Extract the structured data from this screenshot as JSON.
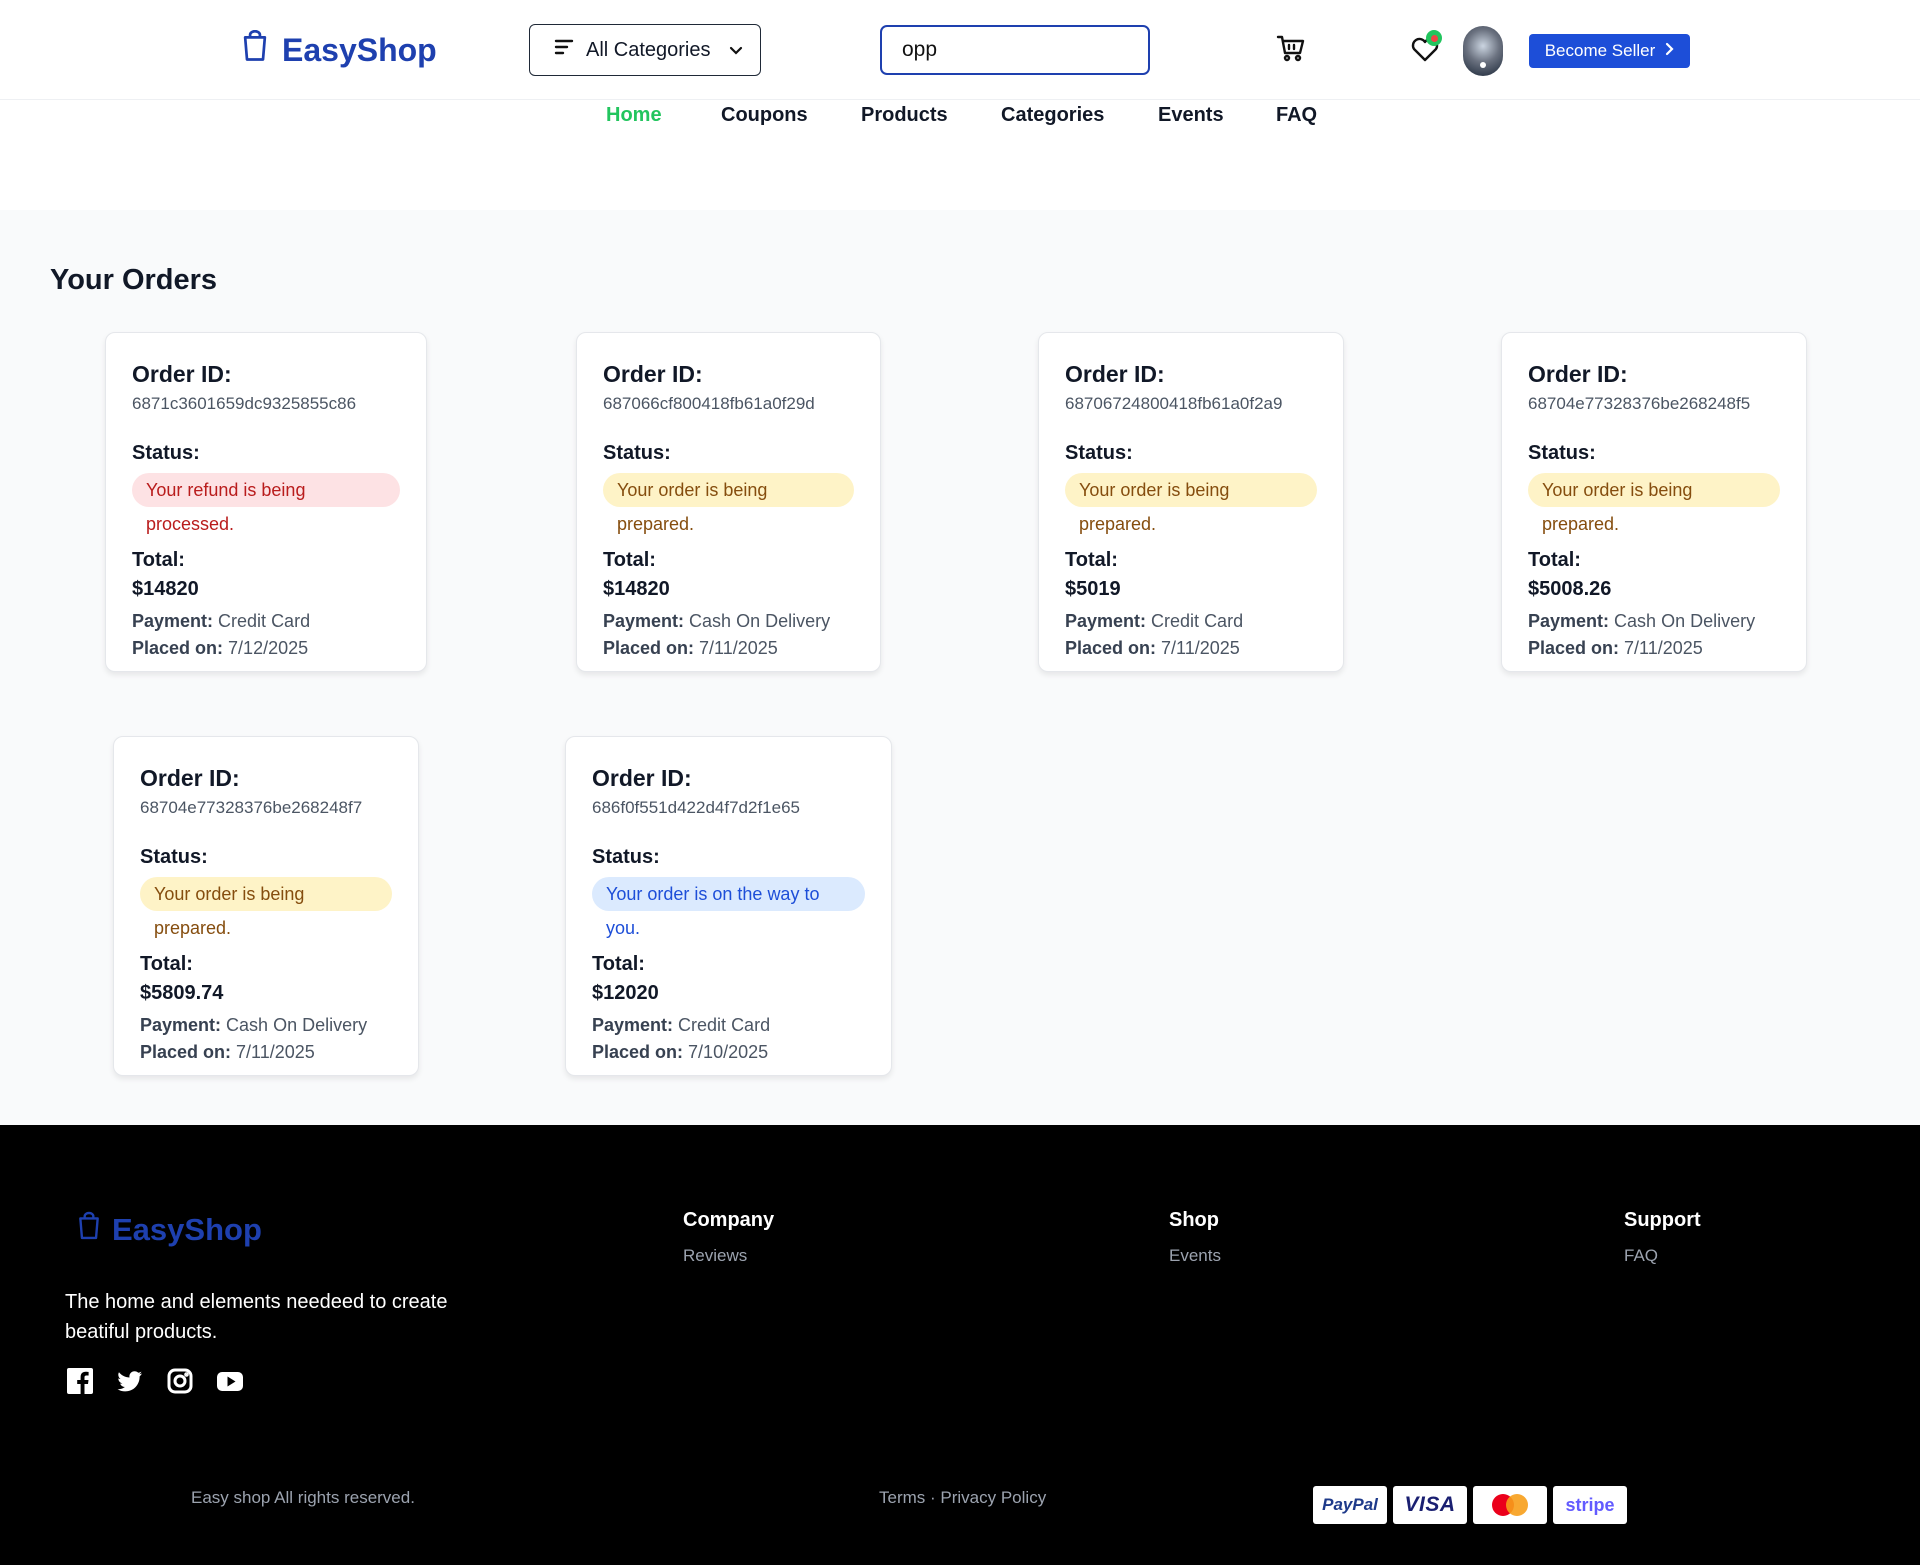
{
  "header": {
    "brand": "EasyShop",
    "categories_label": "All Categories",
    "search_value": "opp",
    "seller_label": "Become Seller"
  },
  "nav": {
    "items": [
      "Home",
      "Coupons",
      "Products",
      "Categories",
      "Events",
      "FAQ"
    ],
    "active": "Home"
  },
  "orders": {
    "title": "Your Orders",
    "labels": {
      "order_id": "Order ID:",
      "status": "Status:",
      "total": "Total:",
      "payment": "Payment:",
      "placed_on": "Placed on:"
    },
    "items": [
      {
        "id": "6871c3601659dc9325855c86",
        "status": "Your refund is being processed.",
        "status_color": "#b91c1c",
        "total": "$14820",
        "payment": "Credit Card",
        "placed_on": "7/12/2025"
      },
      {
        "id": "687066cf800418fb61a0f29d",
        "status": "Your order is being prepared.",
        "status_color": "#854d0e",
        "total": "$14820",
        "payment": "Cash On Delivery",
        "placed_on": "7/11/2025"
      },
      {
        "id": "68706724800418fb61a0f2a9",
        "status": "Your order is being prepared.",
        "status_color": "#854d0e",
        "total": "$5019",
        "payment": "Credit Card",
        "placed_on": "7/11/2025"
      },
      {
        "id": "68704e77328376be268248f5",
        "status": "Your order is being prepared.",
        "status_color": "#854d0e",
        "total": "$5008.26",
        "payment": "Cash On Delivery",
        "placed_on": "7/11/2025"
      },
      {
        "id": "68704e77328376be268248f7",
        "status": "Your order is being prepared.",
        "status_color": "#854d0e",
        "total": "$5809.74",
        "payment": "Cash On Delivery",
        "placed_on": "7/11/2025"
      },
      {
        "id": "686f0f551d422d4f7d2f1e65",
        "status": "Your order is on the way to you.",
        "status_color": "#1d4ed8",
        "total": "$12020",
        "payment": "Credit Card",
        "placed_on": "7/10/2025"
      }
    ]
  },
  "footer": {
    "brand": "EasyShop",
    "tagline": "The home and elements needeed to create beatiful products.",
    "columns": [
      {
        "title": "Company",
        "links": [
          "Reviews"
        ]
      },
      {
        "title": "Shop",
        "links": [
          "Events"
        ]
      },
      {
        "title": "Support",
        "links": [
          "FAQ"
        ]
      }
    ],
    "copyright": "Easy shop All rights reserved.",
    "terms": "Terms",
    "separator": " · ",
    "privacy": "Privacy Policy",
    "payment_methods": [
      "PayPal",
      "VISA",
      "Mastercard",
      "stripe"
    ],
    "social_icons": [
      "facebook-icon",
      "twitter-icon",
      "instagram-icon",
      "youtube-icon"
    ]
  },
  "colors": {
    "brand": "#1e40af",
    "active_nav": "#22c55e",
    "primary_button": "#1d4ed8"
  }
}
